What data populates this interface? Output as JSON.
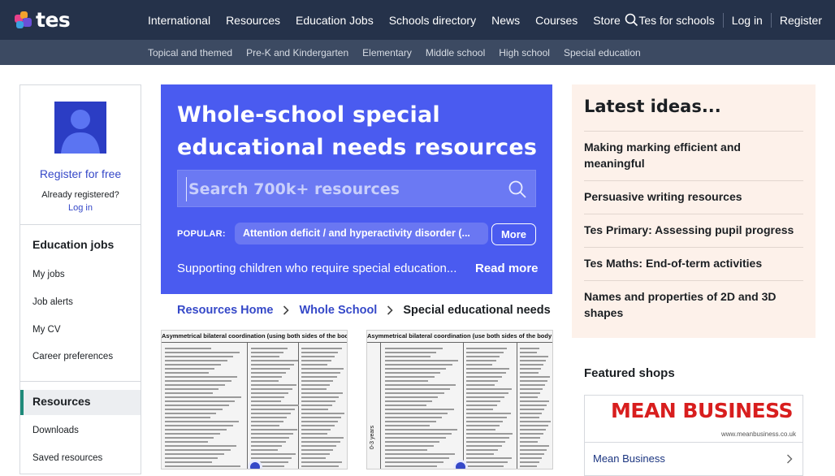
{
  "brand": {
    "logo_text": "tes"
  },
  "nav": {
    "items": [
      "International",
      "Resources",
      "Education Jobs",
      "Schools directory",
      "News",
      "Courses",
      "Store"
    ],
    "tes_for_schools": "Tes for schools",
    "login": "Log in",
    "register": "Register"
  },
  "subnav": {
    "items": [
      "Topical and themed",
      "Pre-K and Kindergarten",
      "Elementary",
      "Middle school",
      "High school",
      "Special education"
    ]
  },
  "sidebar": {
    "register": "Register for free",
    "already": "Already registered?",
    "login": "Log in",
    "jobs_head": "Education jobs",
    "jobs_items": [
      "My jobs",
      "Job alerts",
      "My CV",
      "Career preferences"
    ],
    "resources_head": "Resources",
    "resources_items": [
      "Downloads",
      "Saved resources"
    ]
  },
  "hero": {
    "title": "Whole-school special educational needs resources",
    "search_placeholder": "Search 700k+ resources",
    "popular_label": "POPULAR:",
    "popular_chip": "Attention deficit / and hyperactivity disorder (...",
    "more": "More",
    "description": "Supporting children who require special education...",
    "read_more": "Read more"
  },
  "breadcrumb": {
    "items": [
      "Resources Home",
      "Whole School"
    ],
    "current": "Special educational needs"
  },
  "thumbs": {
    "one_title": "Asymmetrical bilateral coordination (using both sides of the body together to do th",
    "two_title": "Asymmetrical bilateral coordination (use both sides of the body together but wi",
    "two_side": "0-3 years"
  },
  "ideas": {
    "title": "Latest ideas...",
    "items": [
      "Making marking efficient and meaningful",
      "Persuasive writing resources",
      "Tes Primary: Assessing pupil progress",
      "Tes Maths: End-of-term activities",
      "Names and properties of 2D and 3D shapes"
    ]
  },
  "featured": {
    "title": "Featured shops",
    "shop_logo": "MEAN BUSINESS",
    "shop_url": "www.meanbusiness.co.uk",
    "shop_name": "Mean Business"
  },
  "colors": {
    "nav_bg": "#25324a",
    "subnav_bg": "#3c4a62",
    "hero_bg": "#4a5bf0",
    "link": "#3548c8",
    "ideas_bg": "#fdf1ea"
  }
}
